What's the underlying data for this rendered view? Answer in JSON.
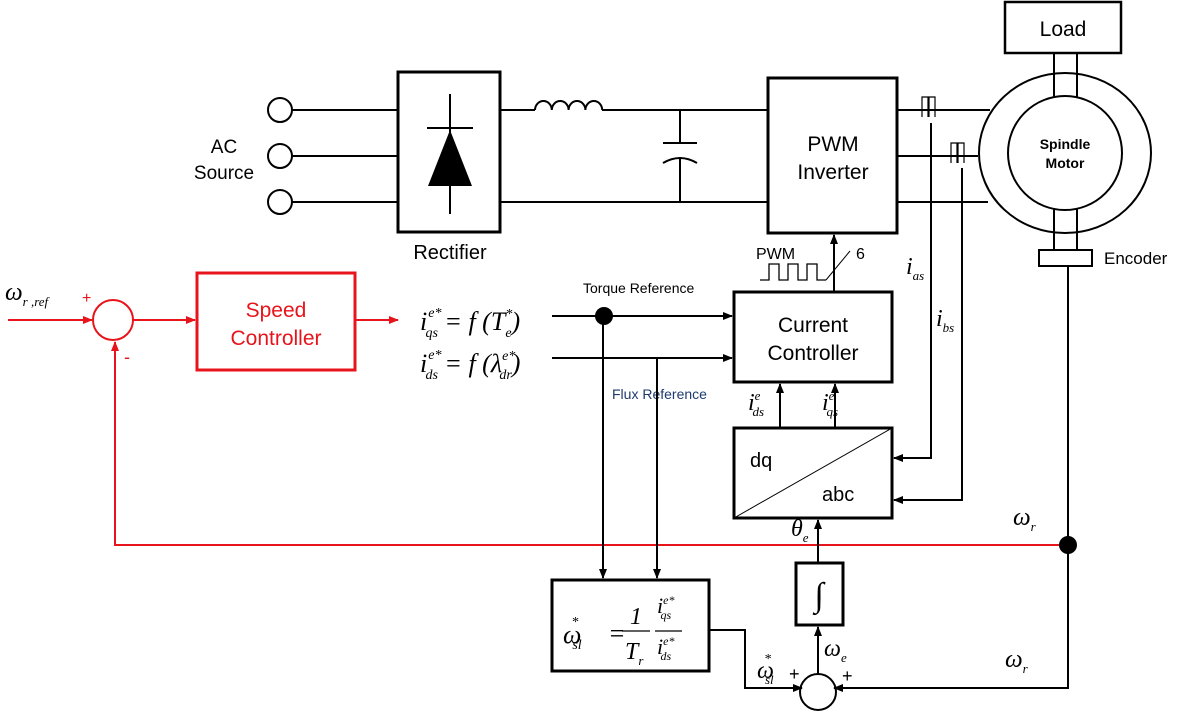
{
  "colors": {
    "control_path": "#e8141b",
    "default": "#000000",
    "flux_label": "#1f3a6e"
  },
  "power": {
    "ac_source": [
      "AC",
      "Source"
    ],
    "rectifier": "Rectifier",
    "inverter": [
      "PWM",
      "Inverter"
    ],
    "load": "Load",
    "motor": [
      "Spindle",
      "Motor"
    ],
    "encoder": "Encoder"
  },
  "pwm": {
    "label": "PWM",
    "count": "6"
  },
  "speed": {
    "ref": {
      "base": "ω",
      "sub": "r ,ref"
    },
    "plus": "+",
    "minus": "-",
    "controller": [
      "Speed",
      "Controller"
    ]
  },
  "refs": {
    "iqs": {
      "base": "i",
      "sup": "e*",
      "sub": "qs",
      "eq": " = f (",
      "arg": "T",
      "arg_sup": "*",
      "arg_sub": "e",
      "close": ")"
    },
    "ids": {
      "base": "i",
      "sup": "e*",
      "sub": "ds",
      "eq": " = f (",
      "arg": "λ",
      "arg_sup": "e*",
      "arg_sub": "dr",
      "close": ")"
    },
    "torque_label": "Torque Reference",
    "flux_label": "Flux Reference"
  },
  "current_controller": [
    "Current",
    "Controller"
  ],
  "transform": {
    "top": "dq",
    "bottom": "abc"
  },
  "feedback": {
    "ids_e": {
      "base": "i",
      "sup": "e",
      "sub": "ds"
    },
    "iqs_e": {
      "base": "i",
      "sup": "e",
      "sub": "qs"
    },
    "ias": {
      "base": "i",
      "sub": "as"
    },
    "ibs": {
      "base": "i",
      "sub": "bs"
    },
    "theta": {
      "base": "θ",
      "sub": "e"
    },
    "omega_r": {
      "base": "ω",
      "sub": "r"
    },
    "omega_e": {
      "base": "ω",
      "sub": "e"
    },
    "omega_sl": {
      "base": "ω",
      "sup": "*",
      "sub": "sl"
    },
    "plus": "+"
  },
  "slip": {
    "lhs": "ω",
    "lhs_sup": "*",
    "lhs_sub": "sl",
    "eq": "=",
    "num1": "1",
    "den1": "T",
    "den1_sub": "r",
    "num2": "i",
    "num2_sup": "e*",
    "num2_sub": "qs",
    "den2": "i",
    "den2_sup": "e*",
    "den2_sub": "ds"
  },
  "integrator": "∫"
}
